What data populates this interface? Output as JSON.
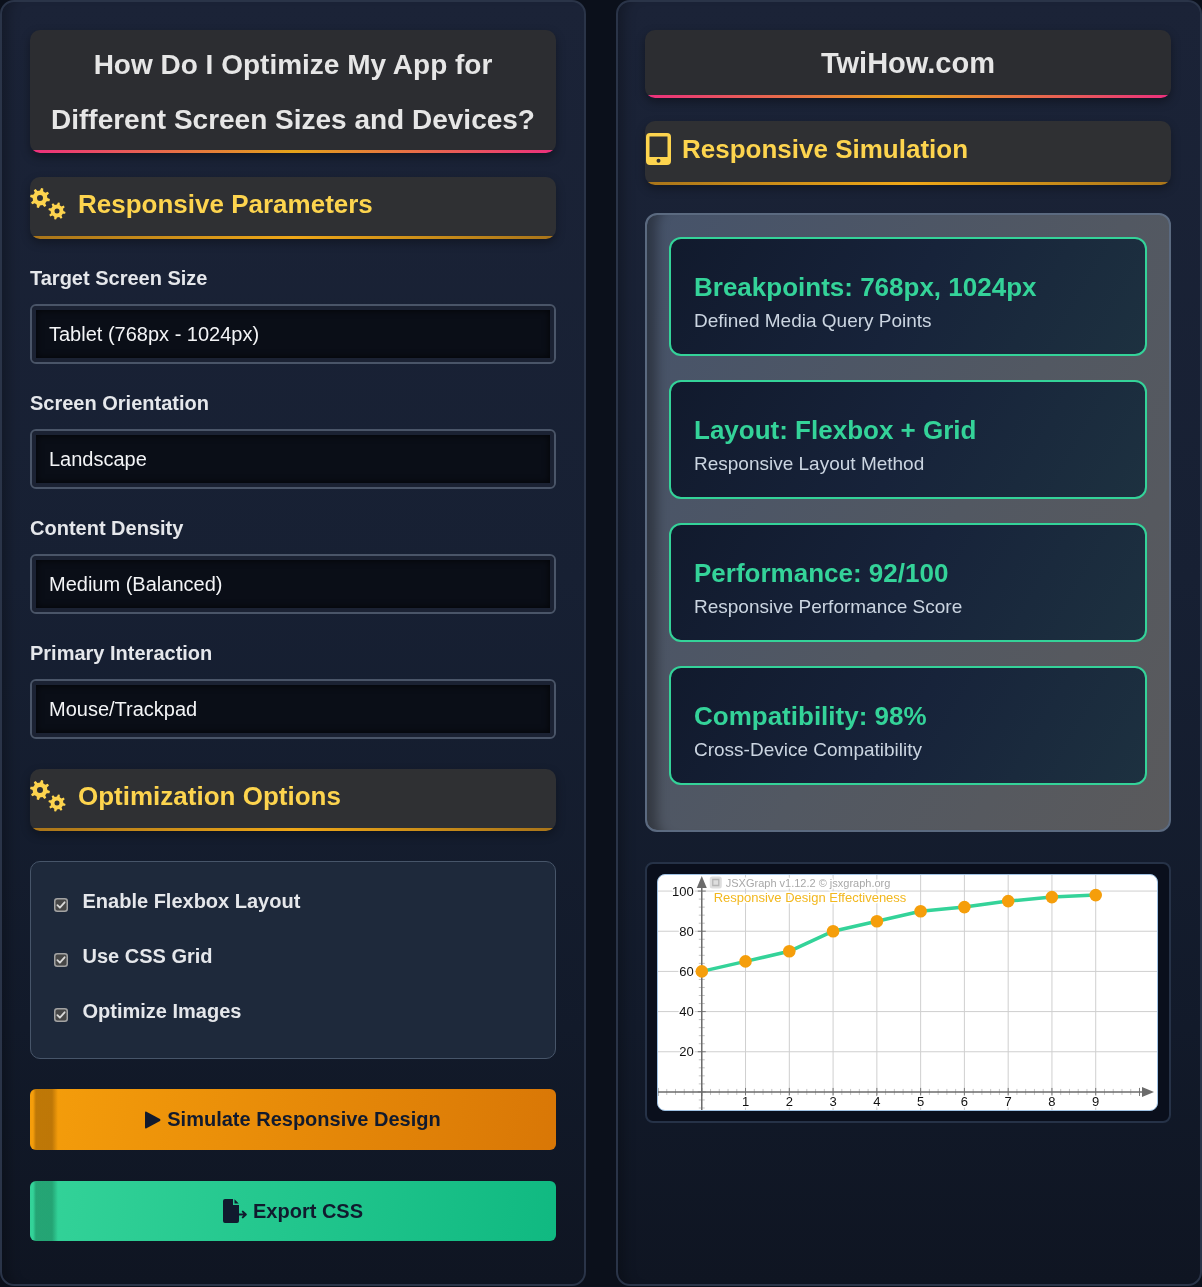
{
  "left_panel": {
    "title": "How Do I Optimize My App for Different Screen Sizes and Devices?",
    "parameters": {
      "heading": "Responsive Parameters",
      "fields": [
        {
          "label": "Target Screen Size",
          "value": "Tablet (768px - 1024px)"
        },
        {
          "label": "Screen Orientation",
          "value": "Landscape"
        },
        {
          "label": "Content Density",
          "value": "Medium (Balanced)"
        },
        {
          "label": "Primary Interaction",
          "value": "Mouse/Trackpad"
        }
      ]
    },
    "options": {
      "heading": "Optimization Options",
      "items": [
        {
          "label": "Enable Flexbox Layout",
          "checked": true
        },
        {
          "label": "Use CSS Grid",
          "checked": true
        },
        {
          "label": "Optimize Images",
          "checked": true
        }
      ]
    },
    "buttons": [
      {
        "kind": "simulate",
        "label": "Simulate Responsive Design"
      },
      {
        "kind": "export",
        "label": "Export CSS"
      }
    ]
  },
  "right_panel": {
    "title": "TwiHow.com",
    "simulation": {
      "heading": "Responsive Simulation",
      "cards": [
        {
          "title": "Breakpoints: 768px, 1024px",
          "caption": "Defined Media Query Points"
        },
        {
          "title": "Layout: Flexbox + Grid",
          "caption": "Responsive Layout Method"
        },
        {
          "title": "Performance: 92/100",
          "caption": "Responsive Performance Score"
        },
        {
          "title": "Compatibility: 98%",
          "caption": "Cross-Device Compatibility"
        }
      ]
    },
    "chart": {
      "credit": "JSXGraph v1.12.2 © jsxgraph.org",
      "chart_data": {
        "type": "line",
        "title": "Responsive Design Effectiveness",
        "x": [
          0,
          1,
          2,
          3,
          4,
          5,
          6,
          7,
          8,
          9
        ],
        "series": [
          {
            "color": "#34d399",
            "marker": "circle",
            "values": [
              60,
              65,
              70,
              80,
              85,
              90,
              92,
              95,
              97,
              98
            ]
          }
        ],
        "xlim": [
          -1,
          10.4
        ],
        "ylim": [
          -9,
          108
        ],
        "xticks": [
          1,
          2,
          3,
          4,
          5,
          6,
          7,
          8,
          9
        ],
        "yticks": [
          20,
          40,
          60,
          80,
          100
        ],
        "grid": true
      }
    }
  }
}
